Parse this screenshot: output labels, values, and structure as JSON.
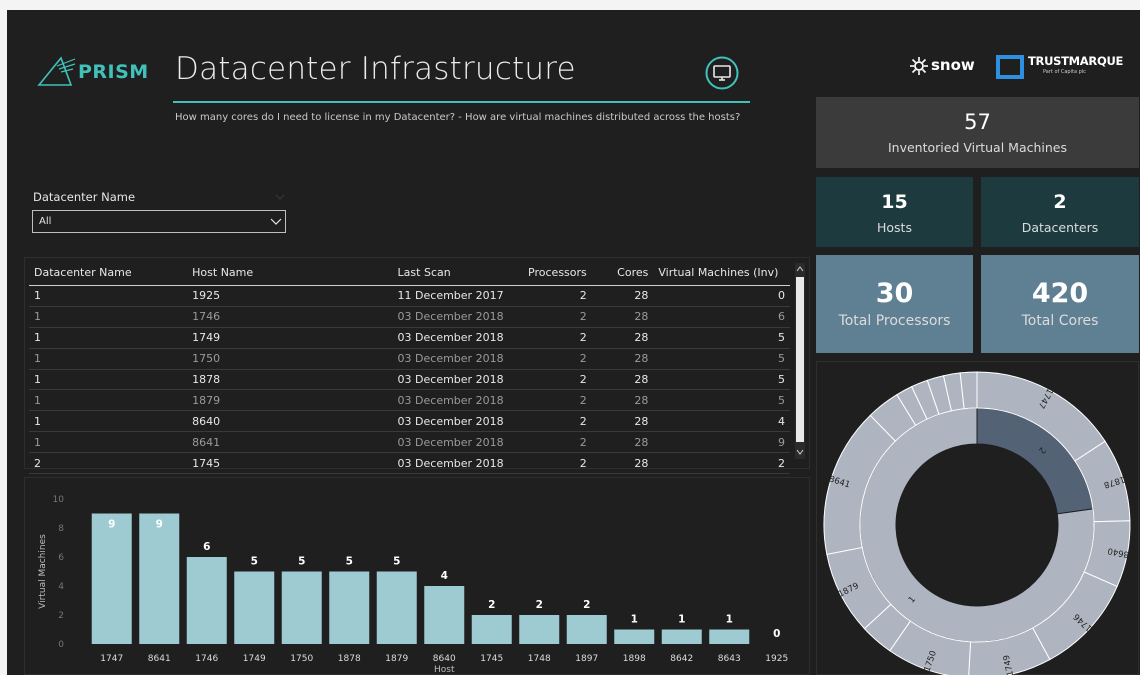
{
  "header": {
    "logo": "PRISM",
    "title": "Datacenter Infrastructure",
    "subtitle": "How many cores do I need to license in my Datacenter?  -  How are virtual machines distributed across the hosts?",
    "partner1": "snow",
    "partner2": "TRUSTMARQUE",
    "partner2_sub": "Part of Capita plc"
  },
  "cards": {
    "vms": {
      "value": "57",
      "label": "Inventoried Virtual Machines"
    },
    "hosts": {
      "value": "15",
      "label": "Hosts"
    },
    "datacenters": {
      "value": "2",
      "label": "Datacenters"
    },
    "processors": {
      "value": "30",
      "label": "Total Processors"
    },
    "cores": {
      "value": "420",
      "label": "Total Cores"
    }
  },
  "slicer": {
    "label": "Datacenter Name",
    "value": "All"
  },
  "table": {
    "columns": [
      "Datacenter Name",
      "Host Name",
      "Last Scan",
      "Processors",
      "Cores",
      "Virtual Machines (Inv)"
    ],
    "rows": [
      [
        "1",
        "1925",
        "11 December 2017",
        "2",
        "28",
        "0"
      ],
      [
        "1",
        "1746",
        "03 December 2018",
        "2",
        "28",
        "6"
      ],
      [
        "1",
        "1749",
        "03 December 2018",
        "2",
        "28",
        "5"
      ],
      [
        "1",
        "1750",
        "03 December 2018",
        "2",
        "28",
        "5"
      ],
      [
        "1",
        "1878",
        "03 December 2018",
        "2",
        "28",
        "5"
      ],
      [
        "1",
        "1879",
        "03 December 2018",
        "2",
        "28",
        "5"
      ],
      [
        "1",
        "8640",
        "03 December 2018",
        "2",
        "28",
        "4"
      ],
      [
        "1",
        "8641",
        "03 December 2018",
        "2",
        "28",
        "9"
      ],
      [
        "2",
        "1745",
        "03 December 2018",
        "2",
        "28",
        "2"
      ]
    ]
  },
  "chart_data": [
    {
      "type": "bar",
      "categories": [
        "1747",
        "8641",
        "1746",
        "1749",
        "1750",
        "1878",
        "1879",
        "8640",
        "1745",
        "1748",
        "1897",
        "1898",
        "8642",
        "8643",
        "1925"
      ],
      "values": [
        9,
        9,
        6,
        5,
        5,
        5,
        5,
        4,
        2,
        2,
        2,
        1,
        1,
        1,
        0
      ],
      "xlabel": "Host",
      "ylabel": "Virtual Machines",
      "ylim": [
        0,
        10
      ],
      "yticks": [
        "0",
        "2",
        "4",
        "6",
        "8",
        "10"
      ],
      "bar_color": "#9ecbd2"
    },
    {
      "type": "pie",
      "inner_ring": {
        "labels": [
          "2",
          "1"
        ],
        "values": [
          13,
          44
        ]
      },
      "outer_ring": {
        "labels": [
          "1747",
          "1878",
          "8640",
          "1746",
          "1749",
          "1750",
          "",
          "1879",
          "8641",
          "",
          "",
          "",
          "",
          "",
          ""
        ],
        "values": [
          9,
          5,
          4,
          6,
          5,
          5,
          2,
          5,
          9,
          2,
          1,
          1,
          1,
          1,
          1
        ]
      },
      "colors": {
        "dc2": "#546276",
        "dc1": "#aeb5c0",
        "outer": "#aeb5c0"
      }
    }
  ]
}
